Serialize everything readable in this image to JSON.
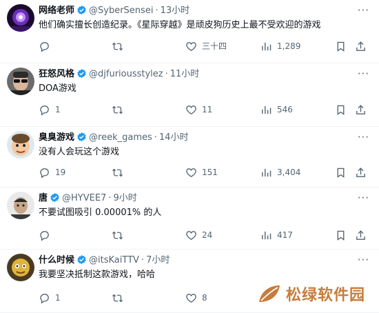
{
  "tweets": [
    {
      "name": "网络老师",
      "handle": "@SyberSensei",
      "dot": "·",
      "time": "13小时",
      "text": "他们确实擅长创造纪录。《星际穿越》是顽皮狗历史上最不受欢迎的游戏",
      "reply_count": "",
      "retweet_count": "",
      "like_count": "三十四",
      "view_count": "1,289",
      "avatar": "purple-glow-avatar"
    },
    {
      "name": "狂怒风格",
      "handle": "@djfuriousstylez",
      "dot": "·",
      "time": "11小时",
      "text": "DOA游戏",
      "reply_count": "1",
      "retweet_count": "",
      "like_count": "11",
      "view_count": "546",
      "avatar": "man-sunglasses-avatar"
    },
    {
      "name": "臭臭游戏",
      "handle": "@reek_games",
      "dot": "·",
      "time": "14小时",
      "text": "没有人会玩这个游戏",
      "reply_count": "19",
      "retweet_count": "",
      "like_count": "151",
      "view_count": "3,404",
      "avatar": "cartoon-face-avatar"
    },
    {
      "name": "唐",
      "handle": "@HYVEE7",
      "dot": "·",
      "time": "9小时",
      "text": "不要试图吸引 0.00001% 的人",
      "reply_count": "",
      "retweet_count": "",
      "like_count": "24",
      "view_count": "417",
      "avatar": "man-portrait-avatar"
    },
    {
      "name": "什么时候",
      "handle": "@itsKaiTTV",
      "dot": "·",
      "time": "7小时",
      "text": "我要坚决抵制这款游戏，哈哈",
      "reply_count": "1",
      "retweet_count": "",
      "like_count": "8",
      "view_count": "",
      "avatar": "yellow-character-avatar"
    }
  ],
  "more_label": "···",
  "watermark": {
    "text": "松绿软件园",
    "color": "#c77c3b"
  },
  "colors": {
    "verified": "#1d9bf0",
    "muted": "#536471",
    "divider": "#eff3f4"
  }
}
